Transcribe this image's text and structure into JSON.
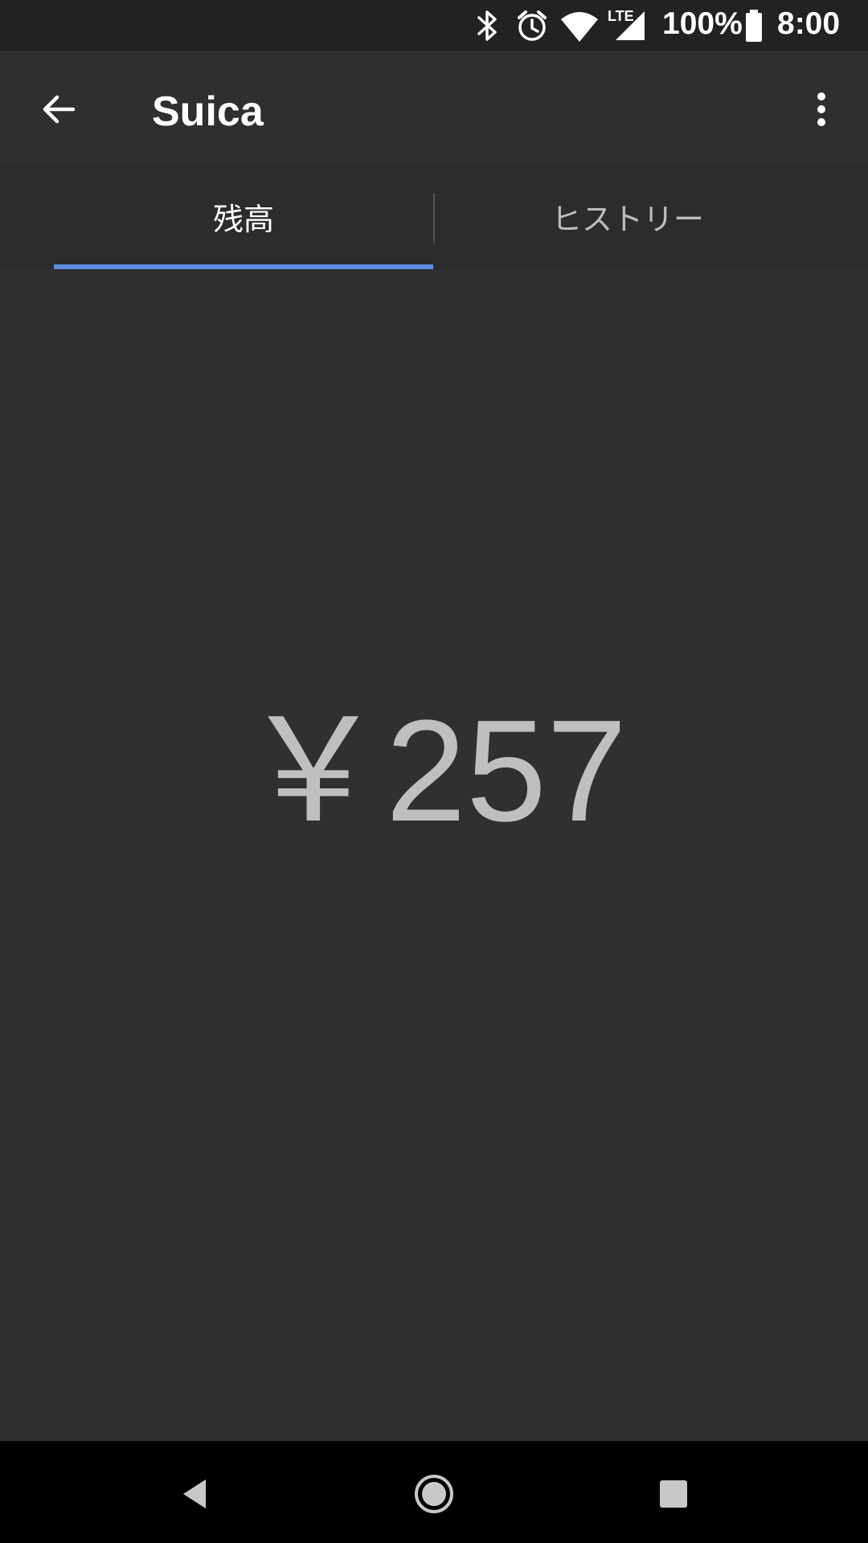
{
  "status_bar": {
    "icons": [
      "bluetooth-icon",
      "alarm-icon",
      "wifi-icon",
      "lte-signal-icon",
      "battery-icon"
    ],
    "lte_label": "LTE",
    "battery_percent": "100%",
    "time": "8:00"
  },
  "app_bar": {
    "title": "Suica",
    "back_icon": "arrow-back-icon",
    "menu_icon": "more-vert-icon"
  },
  "tabs": [
    {
      "label": "残高",
      "selected": true
    },
    {
      "label": "ヒストリー",
      "selected": false
    }
  ],
  "balance": {
    "amount_text": "￥257"
  },
  "nav_bar": {
    "icons": [
      "nav-back-icon",
      "nav-home-icon",
      "nav-recents-icon"
    ]
  },
  "colors": {
    "background": "#303030",
    "status_bar": "#222222",
    "accent": "#5c8fe0",
    "balance_text": "#bfbfbf"
  }
}
